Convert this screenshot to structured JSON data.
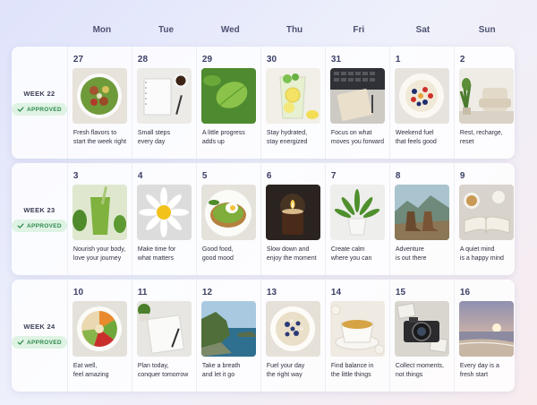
{
  "day_headers": [
    "Mon",
    "Tue",
    "Wed",
    "Thu",
    "Fri",
    "Sat",
    "Sun"
  ],
  "status_label": "APPROVED",
  "accent_green": "#2d8a4b",
  "weeks": [
    {
      "label": "WEEK 22",
      "days": [
        {
          "date": "27",
          "caption": "Fresh flavors to\nstart the week right",
          "image": "salad-bowl-image"
        },
        {
          "date": "28",
          "caption": "Small steps\nevery day",
          "image": "notebook-coffee-image"
        },
        {
          "date": "29",
          "caption": "A little progress\nadds up",
          "image": "green-leaf-image"
        },
        {
          "date": "30",
          "caption": "Stay hydrated,\nstay energized",
          "image": "lemon-water-image"
        },
        {
          "date": "31",
          "caption": "Focus on what\nmoves you forward",
          "image": "laptop-notebook-image"
        },
        {
          "date": "1",
          "caption": "Weekend fuel\nthat feels good",
          "image": "fruit-plate-image"
        },
        {
          "date": "2",
          "caption": "Rest, recharge,\nreset",
          "image": "armchair-plant-image"
        }
      ]
    },
    {
      "label": "WEEK 23",
      "days": [
        {
          "date": "3",
          "caption": "Nourish your body,\nlove your journey",
          "image": "green-smoothie-image"
        },
        {
          "date": "4",
          "caption": "Make time for\nwhat matters",
          "image": "daisy-image"
        },
        {
          "date": "5",
          "caption": "Good food,\ngood mood",
          "image": "avocado-toast-image"
        },
        {
          "date": "6",
          "caption": "Slow down and\nenjoy the moment",
          "image": "candle-image"
        },
        {
          "date": "7",
          "caption": "Create calm\nwhere you can",
          "image": "potted-plant-image"
        },
        {
          "date": "8",
          "caption": "Adventure\nis out there",
          "image": "hiking-boots-image"
        },
        {
          "date": "9",
          "caption": "A quiet mind\nis a happy mind",
          "image": "book-tea-image"
        }
      ]
    },
    {
      "label": "WEEK 24",
      "days": [
        {
          "date": "10",
          "caption": "Eat well,\nfeel amazing",
          "image": "veggie-bowl-image"
        },
        {
          "date": "11",
          "caption": "Plan today,\nconquer tomorrow",
          "image": "notebook-plant-image"
        },
        {
          "date": "12",
          "caption": "Take a breath\nand let it go",
          "image": "coast-image"
        },
        {
          "date": "13",
          "caption": "Fuel your day\nthe right way",
          "image": "oatmeal-image"
        },
        {
          "date": "14",
          "caption": "Find balance in\nthe little things",
          "image": "tea-cup-image"
        },
        {
          "date": "15",
          "caption": "Collect moments,\nnot things",
          "image": "camera-image"
        },
        {
          "date": "16",
          "caption": "Every day is a\nfresh start",
          "image": "sunset-beach-image"
        }
      ]
    }
  ]
}
